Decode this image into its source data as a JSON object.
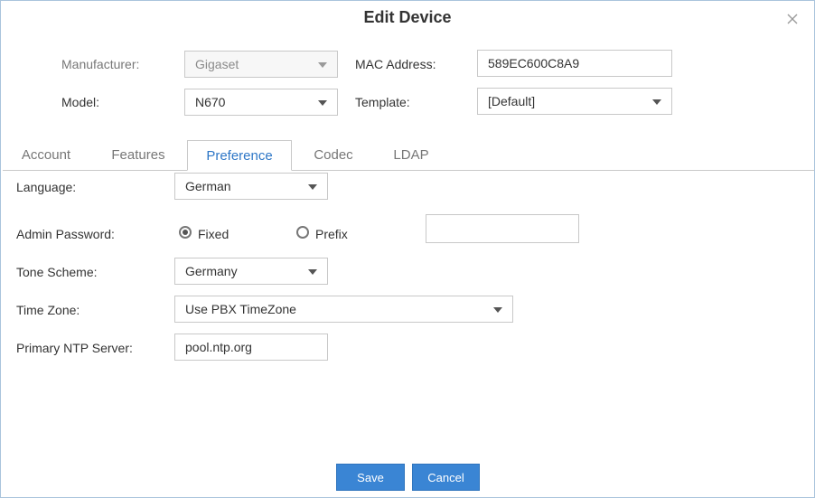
{
  "dialog": {
    "title": "Edit Device"
  },
  "device": {
    "manufacturer_label": "Manufacturer:",
    "manufacturer_value": "Gigaset",
    "mac_label": "MAC Address:",
    "mac_value": "589EC600C8A9",
    "model_label": "Model:",
    "model_value": "N670",
    "template_label": "Template:",
    "template_value": "[Default]"
  },
  "tabs": [
    {
      "label": "Account",
      "active": false
    },
    {
      "label": "Features",
      "active": false
    },
    {
      "label": "Preference",
      "active": true
    },
    {
      "label": "Codec",
      "active": false
    },
    {
      "label": "LDAP",
      "active": false
    }
  ],
  "preference": {
    "language_label": "Language:",
    "language_value": "German",
    "admin_password_label": "Admin Password:",
    "admin_password_options": [
      {
        "label": "Fixed",
        "selected": true
      },
      {
        "label": "Prefix",
        "selected": false
      }
    ],
    "admin_password_value": "",
    "tone_scheme_label": "Tone Scheme:",
    "tone_scheme_value": "Germany",
    "time_zone_label": "Time Zone:",
    "time_zone_value": "Use PBX TimeZone",
    "ntp_label": "Primary NTP Server:",
    "ntp_value": "pool.ntp.org"
  },
  "buttons": {
    "save": "Save",
    "cancel": "Cancel"
  },
  "colors": {
    "accent": "#3a85d4",
    "active_tab_text": "#2e77c7",
    "border": "#c8c8c8"
  },
  "icons": {
    "close": "close-icon",
    "dropdown": "chevron-down-icon"
  }
}
